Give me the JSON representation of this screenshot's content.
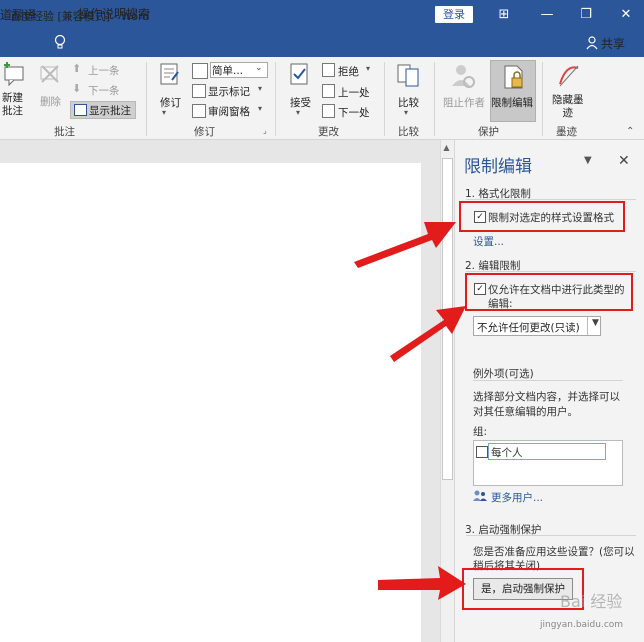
{
  "window": {
    "title": "百度经验 [兼容模式]  -  Word",
    "signin_label": "登录",
    "controls": [
      "⊞",
      "—",
      "❐",
      "✕"
    ]
  },
  "tellbar": {
    "left_partial": "道翻译",
    "search_label": "操作说明搜索",
    "share_label": "共享"
  },
  "ribbon": {
    "groups": {
      "comments": {
        "label": "批注",
        "new_comment": "新建\n批注",
        "new_comment_l1": "新建",
        "new_comment_l2": "批注",
        "delete": "删除",
        "prev": "上一条",
        "next": "下一条",
        "show_comments": "显示批注"
      },
      "tracking": {
        "label": "修订",
        "track_changes": "修订",
        "simple_markup": "简单...",
        "show_markup": "显示标记",
        "reviewing_pane": "审阅窗格"
      },
      "changes": {
        "label": "更改",
        "accept": "接受",
        "reject": "拒绝",
        "previous": "上一处",
        "next": "下一处"
      },
      "compare": {
        "label": "比较",
        "compare": "比较"
      },
      "protect": {
        "label": "保护",
        "block_authors_l1": "阻止作者",
        "restrict_editing": "限制编辑"
      },
      "ink": {
        "label": "墨迹",
        "hide_ink_l1": "隐藏墨",
        "hide_ink_l2": "迹"
      }
    }
  },
  "pane": {
    "title": "限制编辑",
    "section1": {
      "heading": "1. 格式化限制",
      "checkbox_label": "限制对选定的样式设置格式",
      "checked": true,
      "settings_link": "设置..."
    },
    "section2": {
      "heading": "2. 编辑限制",
      "checkbox_label_l1": "仅允许在文档中进行此类型的",
      "checkbox_label_l2": "编辑:",
      "checked": true,
      "dropdown_value": "不允许任何更改(只读)",
      "exceptions_heading": "例外项(可选)",
      "exceptions_desc_l1": "选择部分文档内容，并选择可以",
      "exceptions_desc_l2": "对其任意编辑的用户。",
      "groups_label": "组:",
      "everyone": "每个人",
      "more_users": "更多用户..."
    },
    "section3": {
      "heading": "3. 启动强制保护",
      "desc_l1": "您是否准备应用这些设置？(您可以",
      "desc_l2": "稍后将其关闭)",
      "start_button": "是，启动强制保护"
    }
  },
  "watermark": {
    "brand": "Bai 经验",
    "url": "jingyan.baidu.com"
  },
  "colors": {
    "accent": "#2b579a",
    "highlight": "#e21b1b"
  }
}
